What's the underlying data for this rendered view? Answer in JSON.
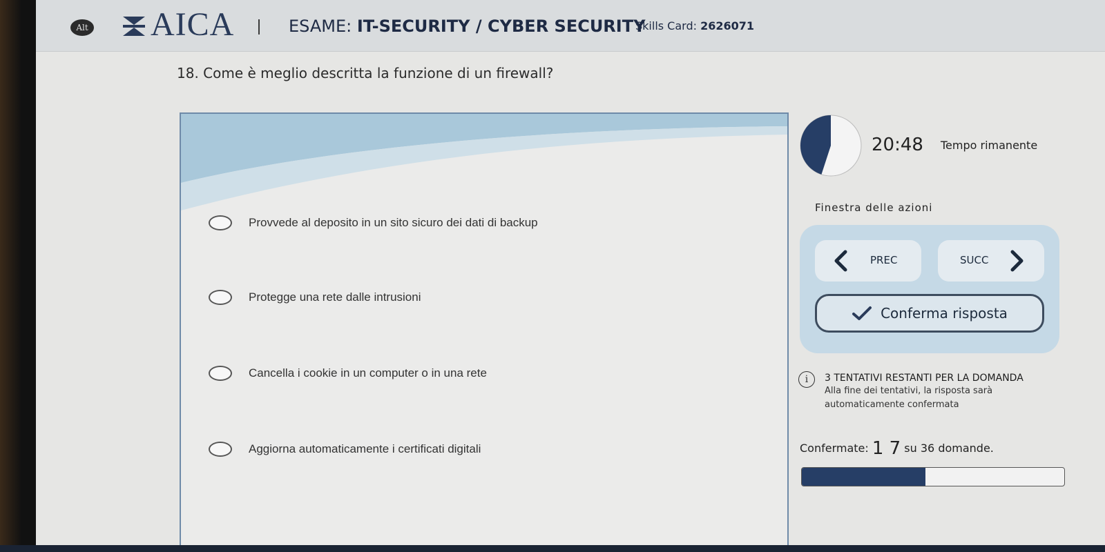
{
  "header": {
    "alt_badge": "Alt",
    "logo_text": "AICA",
    "exam_prefix": "ESAME: ",
    "exam_name": "IT-SECURITY / CYBER SECURITY",
    "skills_label": "Skills Card: ",
    "skills_number": "2626071"
  },
  "question": "18. Come è meglio descritta la funzione di un firewall?",
  "answers": [
    {
      "text": "Provvede al deposito in un sito sicuro dei dati di backup"
    },
    {
      "text": "Protegge una rete dalle intrusioni"
    },
    {
      "text": "Cancella i cookie in un computer o in una rete"
    },
    {
      "text": "Aggiorna automaticamente i certificati digitali"
    }
  ],
  "timer": {
    "value": "20:48",
    "label": "Tempo rimanente",
    "elapsed_fraction": 0.45
  },
  "actions": {
    "title": "Finestra delle azioni",
    "prev_label": "PREC",
    "next_label": "SUCC",
    "confirm_label": "Conferma risposta"
  },
  "attempts": {
    "title": "3 TENTATIVI RESTANTI PER LA DOMANDA",
    "note": "Alla fine dei tentativi, la risposta sarà automaticamente confermata"
  },
  "progress": {
    "label_prefix": "Confermate: ",
    "confirmed": "1 7",
    "label_suffix": " su 36 domande.",
    "fraction": 0.47
  },
  "colors": {
    "accent": "#263e66",
    "action_box": "#c5d9e6"
  }
}
